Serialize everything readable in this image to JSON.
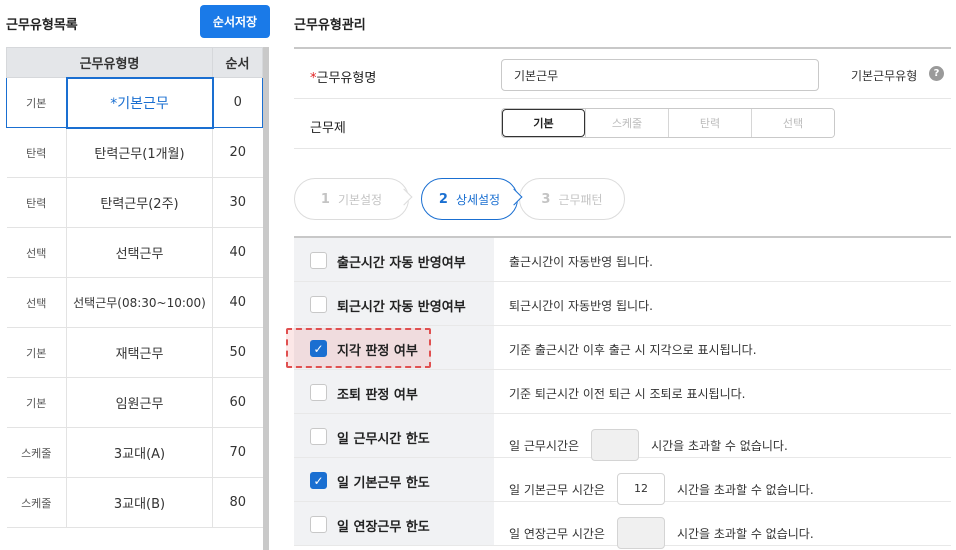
{
  "left": {
    "title": "근무유형목록",
    "save_label": "순서저장",
    "columns": {
      "name": "근무유형명",
      "order": "순서"
    },
    "rows": [
      {
        "type": "기본",
        "name": "*기본근무",
        "order": "0"
      },
      {
        "type": "탄력",
        "name": "탄력근무(1개월)",
        "order": "20"
      },
      {
        "type": "탄력",
        "name": "탄력근무(2주)",
        "order": "30"
      },
      {
        "type": "선택",
        "name": "선택근무",
        "order": "40"
      },
      {
        "type": "선택",
        "name": "선택근무(08:30~10:00)",
        "order": "40"
      },
      {
        "type": "기본",
        "name": "재택근무",
        "order": "50"
      },
      {
        "type": "기본",
        "name": "임원근무",
        "order": "60"
      },
      {
        "type": "스케줄",
        "name": "3교대(A)",
        "order": "70"
      },
      {
        "type": "스케줄",
        "name": "3교대(B)",
        "order": "80"
      }
    ]
  },
  "right": {
    "title": "근무유형관리",
    "name_label_req": "*",
    "name_label": "근무유형명",
    "name_value": "기본근무",
    "default_label": "기본근무유형",
    "help_icon": "?",
    "work_system_label": "근무제",
    "work_system_options": [
      "기본",
      "스케줄",
      "탄력",
      "선택"
    ],
    "steps": [
      {
        "n": "1",
        "label": "기본설정"
      },
      {
        "n": "2",
        "label": "상세설정"
      },
      {
        "n": "3",
        "label": "근무패턴"
      }
    ],
    "settings": [
      {
        "label": "출근시간 자동 반영여부",
        "desc": "출근시간이 자동반영 됩니다."
      },
      {
        "label": "퇴근시간 자동 반영여부",
        "desc": "퇴근시간이 자동반영 됩니다."
      },
      {
        "label": "지각 판정 여부",
        "desc": "기준 출근시간 이후 출근 시 지각으로 표시됩니다."
      },
      {
        "label": "조퇴 판정 여부",
        "desc": "기준 퇴근시간 이전 퇴근 시 조퇴로 표시됩니다."
      },
      {
        "label": "일 근무시간 한도",
        "pre": "일 근무시간은",
        "post": "시간을 초과할 수 없습니다."
      },
      {
        "label": "일 기본근무 한도",
        "pre": "일 기본근무 시간은",
        "value": "12",
        "post": "시간을 초과할 수 없습니다."
      },
      {
        "label": "일 연장근무 한도",
        "pre": "일 연장근무 시간은",
        "post": "시간을 초과할 수 없습니다."
      }
    ],
    "check_mark": "✓"
  }
}
